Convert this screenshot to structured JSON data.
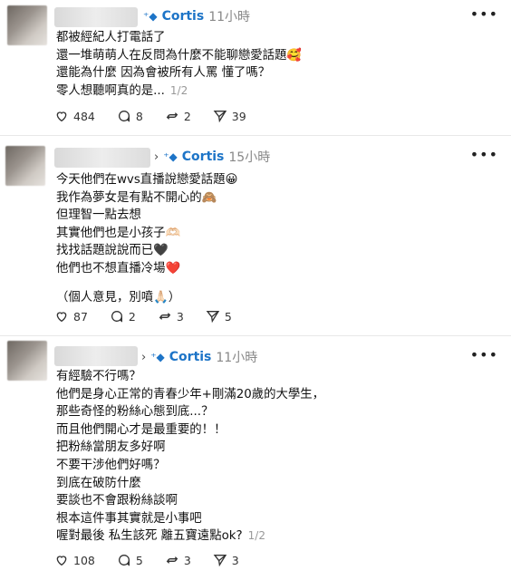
{
  "posts": [
    {
      "topic": "Cortis",
      "time": "11小時",
      "lines": [
        "都被經紀人打電話了",
        "還一堆萌萌人在反問為什麼不能聊戀愛話題🥰",
        "還能為什麼 因為會被所有人罵 懂了嗎？",
        "零人想聽啊真的是..."
      ],
      "page": "1/2",
      "likes": "484",
      "comments": "8",
      "reposts": "2",
      "shares": "39"
    },
    {
      "topic": "Cortis",
      "time": "15小時",
      "lines": [
        "今天他們在wvs直播說戀愛話題😀",
        "我作為夢女是有點不開心的🙈",
        "但理智一點去想",
        "其實他們也是小孩子🫶🏻",
        "找找話題說說而已🖤",
        "他們也不想直播冷場❤️"
      ],
      "note": "（個人意見，別噴🙏🏻）",
      "likes": "87",
      "comments": "2",
      "reposts": "3",
      "shares": "5"
    },
    {
      "topic": "Cortis",
      "time": "11小時",
      "lines": [
        "有經驗不行嗎？",
        "他們是身心正常的青春少年+剛滿20歲的大學生，",
        "那些奇怪的粉絲心態到底...？",
        "而且他們開心才是最重要的！！",
        "把粉絲當朋友多好啊",
        "不要干涉他們好嗎？",
        "到底在破防什麼",
        "要談也不會跟粉絲談啊",
        "根本這件事其實就是小事吧",
        "喔對最後 私生該死 離五寶遠點ok?"
      ],
      "page": "1/2",
      "likes": "108",
      "comments": "5",
      "reposts": "3",
      "shares": "3"
    }
  ],
  "icons": {
    "more": "more-horizontal-icon",
    "like": "heart-icon",
    "comment": "comment-bubble-icon",
    "repost": "repost-icon",
    "share": "share-icon",
    "topic": "topic-tag-icon"
  },
  "colors": {
    "topic": "#1d74c7",
    "time": "#888888"
  }
}
